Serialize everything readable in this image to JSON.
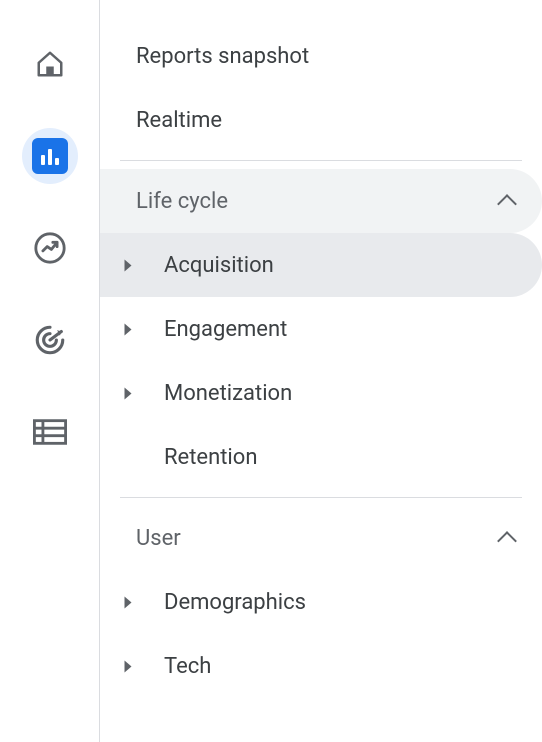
{
  "topNav": {
    "reportsSnapshot": "Reports snapshot",
    "realtime": "Realtime"
  },
  "sections": [
    {
      "label": "Life cycle",
      "shaded": true,
      "items": [
        {
          "label": "Acquisition",
          "hasChildren": true,
          "selected": true
        },
        {
          "label": "Engagement",
          "hasChildren": true,
          "selected": false
        },
        {
          "label": "Monetization",
          "hasChildren": true,
          "selected": false
        },
        {
          "label": "Retention",
          "hasChildren": false,
          "selected": false
        }
      ]
    },
    {
      "label": "User",
      "shaded": false,
      "items": [
        {
          "label": "Demographics",
          "hasChildren": true,
          "selected": false
        },
        {
          "label": "Tech",
          "hasChildren": true,
          "selected": false
        }
      ]
    }
  ]
}
